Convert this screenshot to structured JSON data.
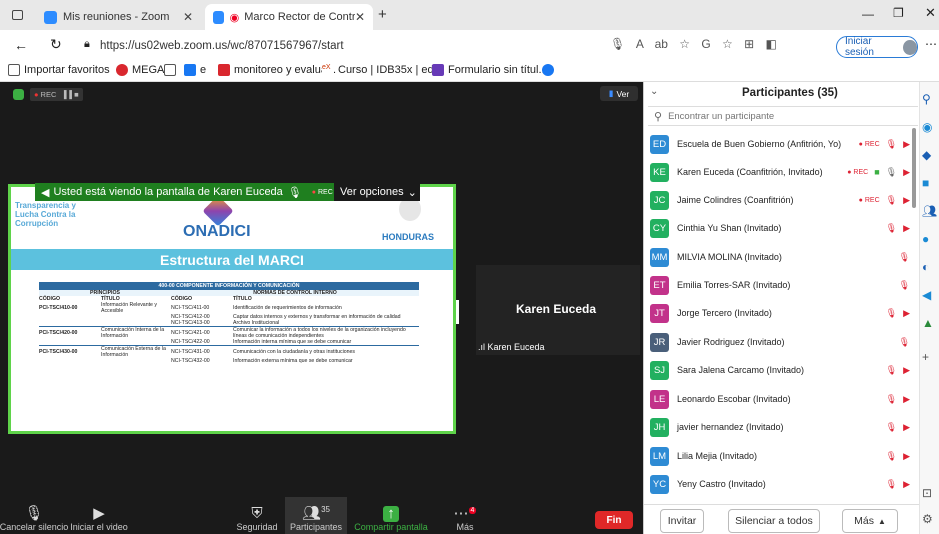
{
  "tabs": [
    {
      "label": "Mis reuniones - Zoom"
    },
    {
      "label": "Marco Rector de Control Int"
    }
  ],
  "address": {
    "url": "https://us02web.zoom.us/wc/87071567967/start",
    "signin": "Iniciar sesión"
  },
  "favorites": [
    "Importar favoritos",
    "MEGA",
    "e",
    "monitoreo y evalua...",
    "Curso | IDB35x | edX",
    "Formulario sin títul..."
  ],
  "meeting": {
    "rec": "REC",
    "view_btn": "Ver",
    "share_banner": "Usted está viendo la pantalla de Karen Euceda",
    "share_rec": "REC",
    "options": "Ver opciones",
    "tile_name": "Karen Euceda",
    "tile_label": "Karen Euceda"
  },
  "slide": {
    "org1": "Transparencia y",
    "org2": "Lucha Contra la",
    "org3": "Corrupción",
    "logo": "ONADICI",
    "country": "HONDURAS",
    "title": "Estructura del MARCI",
    "component": "400-00 COMPONENTE INFORMACIÓN Y COMUNICACIÓN",
    "h_principios": "PRINCIPIOS",
    "h_normas": "NORMAS DE CONTROL INTERNO",
    "h_codigo": "CÓDIGO",
    "h_titulo": "TÍTULO",
    "h_codigo2": "CÓDIGO",
    "h_titulo2": "TÍTULO",
    "rows": [
      {
        "pc": "PCI-TSC/410-00",
        "pt": "Información Relevante y Accesible",
        "nc": "NCI-TSC/411-00",
        "nt": "Identificación de requerimientos de información"
      },
      {
        "pc": "",
        "pt": "",
        "nc": "NCI-TSC/412-00",
        "nt": "Captar datos internos y externos y transformar en información de calidad"
      },
      {
        "pc": "",
        "pt": "",
        "nc": "NCI-TSC/413-00",
        "nt": "Archivo Institucional"
      },
      {
        "pc": "PCI-TSC/420-00",
        "pt": "Comunicación Interna de la Información",
        "nc": "NCI-TSC/421-00",
        "nt": "Comunicar la información a todos los niveles de la organización incluyendo líneas de comunicación independientes"
      },
      {
        "pc": "",
        "pt": "",
        "nc": "NCI-TSC/422-00",
        "nt": "Información interna mínima que se debe comunicar"
      },
      {
        "pc": "PCI-TSC/430-00",
        "pt": "Comunicación Externa de la Información",
        "nc": "NCI-TSC/431-00",
        "nt": "Comunicación con la ciudadanía y otras instituciones"
      },
      {
        "pc": "",
        "pt": "",
        "nc": "NCI-TSC/432-00",
        "nt": "Información externa mínima que se debe comunicar"
      }
    ]
  },
  "controls": {
    "mute": "Cancelar silencio",
    "video": "Iniciar el video",
    "security": "Seguridad",
    "participants": "Participantes",
    "participants_count": "35",
    "share": "Compartir pantalla",
    "more": "Más",
    "more_badge": "4",
    "end": "Fin"
  },
  "panel": {
    "title": "Participantes (35)",
    "search_placeholder": "Encontrar un participante",
    "invite": "Invitar",
    "mute_all": "Silenciar a todos",
    "more": "Más",
    "participants": [
      {
        "initials": "ED",
        "name": "Escuela de Buen Gobierno (Anfitrión, Yo)",
        "color": "#2e8bd4",
        "rec": "REC"
      },
      {
        "initials": "KE",
        "name": "Karen Euceda (Coanfitrión, Invitado)",
        "color": "#22b060",
        "rec": "REC"
      },
      {
        "initials": "JC",
        "name": "Jaime Colindres (Coanfitrión)",
        "color": "#22b060",
        "rec": "REC"
      },
      {
        "initials": "CY",
        "name": "Cinthia Yu Shan (Invitado)",
        "color": "#22b060",
        "rec": ""
      },
      {
        "initials": "MM",
        "name": "MILVIA MOLINA (Invitado)",
        "color": "#2e8bd4",
        "rec": ""
      },
      {
        "initials": "ET",
        "name": "Emilia Torres-SAR (Invitado)",
        "color": "#c2328a",
        "rec": ""
      },
      {
        "initials": "JT",
        "name": "Jorge Tercero (Invitado)",
        "color": "#c2328a",
        "rec": ""
      },
      {
        "initials": "JR",
        "name": "Javier Rodriguez (Invitado)",
        "color": "#4a5f7a",
        "rec": ""
      },
      {
        "initials": "SJ",
        "name": "Sara Jalena Carcamo (Invitado)",
        "color": "#22b060",
        "rec": ""
      },
      {
        "initials": "LE",
        "name": "Leonardo Escobar (Invitado)",
        "color": "#c2328a",
        "rec": ""
      },
      {
        "initials": "JH",
        "name": "javier hernandez (Invitado)",
        "color": "#22b060",
        "rec": ""
      },
      {
        "initials": "LM",
        "name": "Lilia Mejia (Invitado)",
        "color": "#2e8bd4",
        "rec": ""
      },
      {
        "initials": "YC",
        "name": "Yeny Castro (Invitado)",
        "color": "#2e8bd4",
        "rec": ""
      }
    ]
  }
}
